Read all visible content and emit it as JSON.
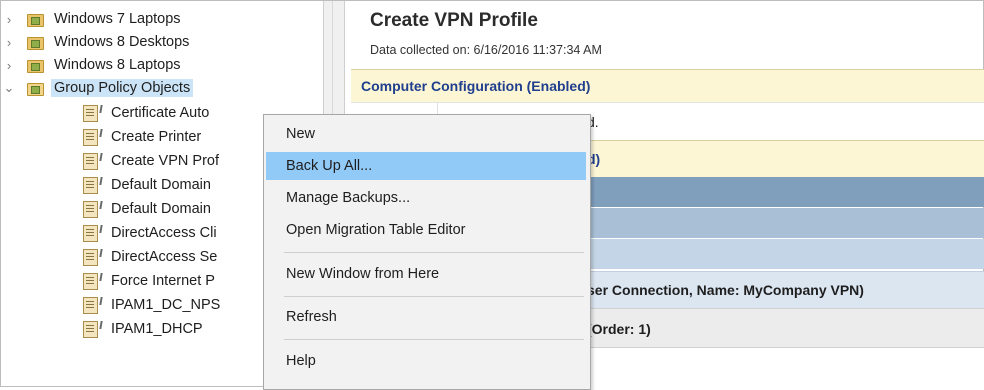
{
  "tree": {
    "ous": [
      {
        "label": "Windows 7 Laptops",
        "expander": "›"
      },
      {
        "label": "Windows 8 Desktops",
        "expander": "›"
      },
      {
        "label": "Windows 8 Laptops",
        "expander": "›"
      },
      {
        "label": "Group Policy Objects",
        "expander": "⌄"
      }
    ],
    "gpos": [
      "Certificate Auto",
      "Create Printer",
      "Create VPN Prof",
      "Default Domain",
      "Default Domain",
      "DirectAccess Cli",
      "DirectAccess Se",
      "Force Internet P",
      "IPAM1_DC_NPS",
      "IPAM1_DHCP"
    ]
  },
  "report": {
    "title": "Create VPN Profile",
    "subtitle": "Data collected on: 6/16/2016 11:37:34 AM",
    "computer_config": "Computer Configuration (Enabled)",
    "row2_text": "d.",
    "row3_text": "d)",
    "connection_text": "ser Connection, Name: MyCompany VPN)",
    "order_text": "(Order: 1)"
  },
  "context_menu": {
    "items": [
      "New",
      "Back Up All...",
      "Manage Backups...",
      "Open Migration Table Editor",
      "New Window from Here",
      "Refresh",
      "Help"
    ],
    "highlighted": "Back Up All..."
  },
  "colors": {
    "highlight": "#91c9f7",
    "selection": "#cce4f7",
    "report_heading_blue": "#1f3f8e",
    "yellow_band": "#fdf6d5"
  }
}
